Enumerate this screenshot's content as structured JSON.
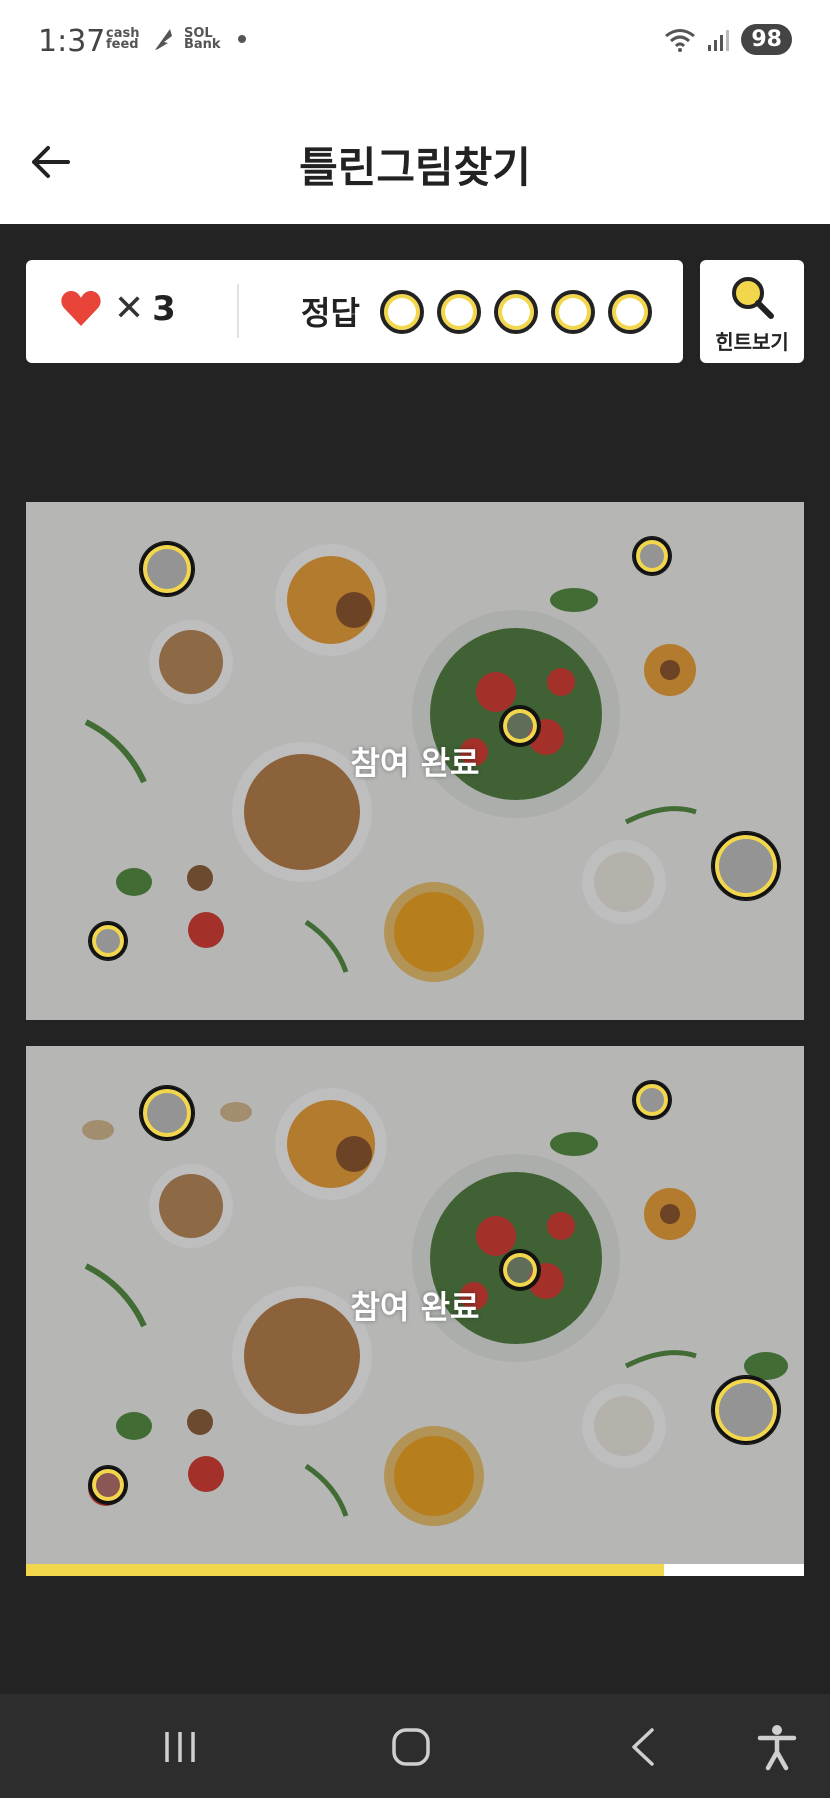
{
  "status_bar": {
    "time": "1:37",
    "app_1": "cash feed",
    "app_2": "SOL Bank",
    "battery": "98"
  },
  "header": {
    "title": "틀린그림찾기",
    "back_icon": "arrow-left-icon"
  },
  "game": {
    "lives_icon": "heart-icon",
    "lives_multiplier": "✕",
    "lives_count": "3",
    "answer_label": "정답",
    "answer_slots_total": 5,
    "answer_slots_found": 0,
    "hint_label": "힌트보기",
    "hint_icon": "magnifier-icon"
  },
  "images": {
    "top_status": "참여 완료",
    "bottom_status": "참여 완료"
  },
  "progress": {
    "fraction": 0.82
  },
  "colors": {
    "accent_yellow": "#f2d64b",
    "heart_red": "#e8443a",
    "background_dark": "#232323"
  },
  "navigation": {
    "recent_apps_icon": "recent-apps-icon",
    "home_icon": "home-icon",
    "back_icon": "back-chevron-icon",
    "accessibility_icon": "accessibility-icon"
  }
}
